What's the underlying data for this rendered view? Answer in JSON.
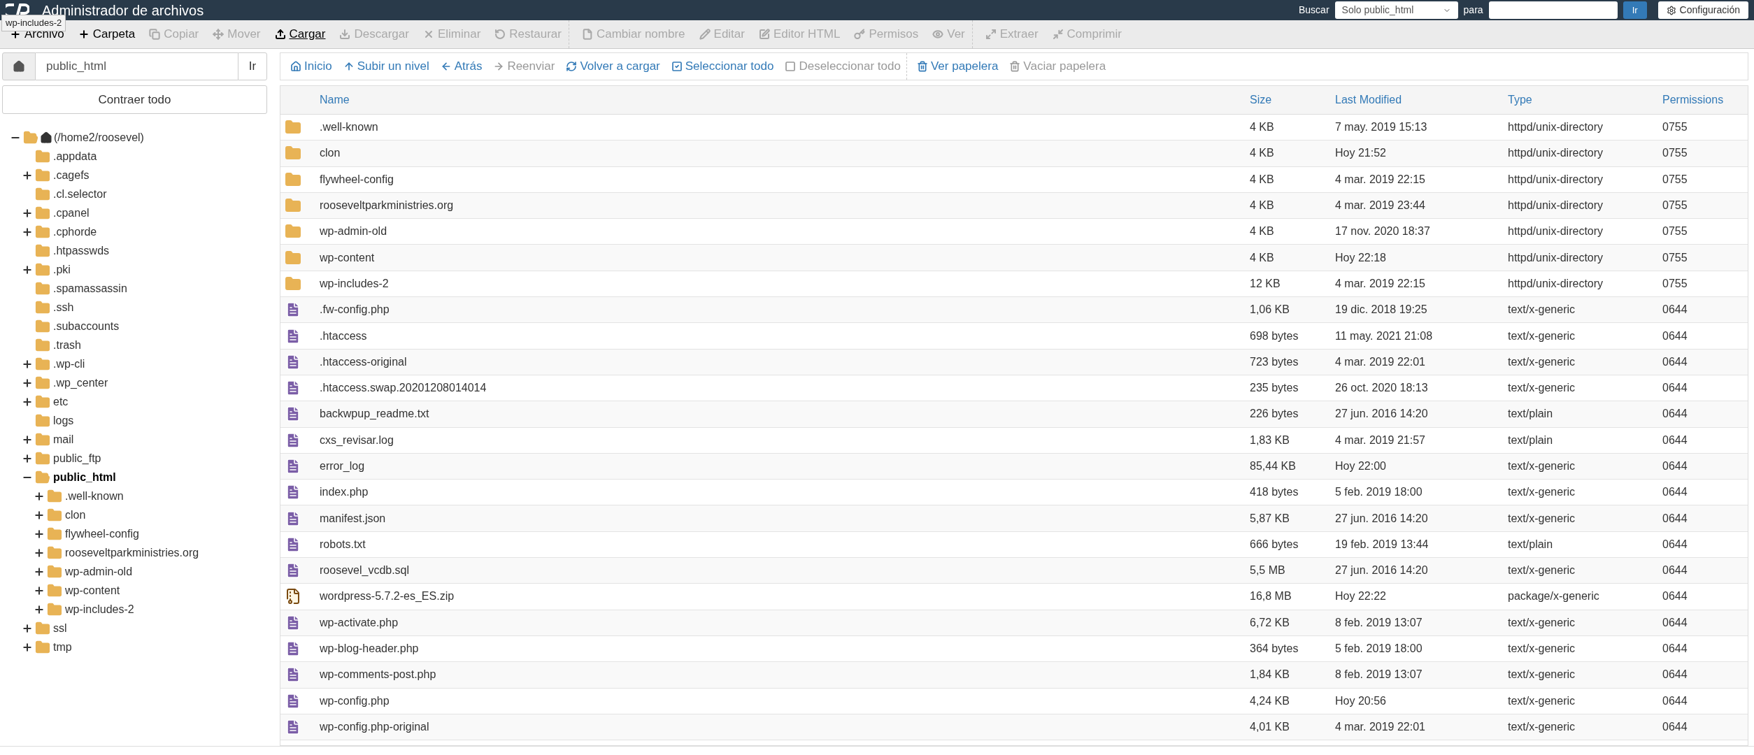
{
  "header": {
    "title": "Administrador de archivos",
    "search_label": "Buscar",
    "search_scope": "Solo public_html",
    "for_label": "para",
    "go_button": "Ir",
    "settings_button": "Configuración"
  },
  "toolbar": [
    [
      {
        "label": "Archivo",
        "disabled": false,
        "hovered": false
      },
      {
        "label": "Carpeta",
        "disabled": false,
        "hovered": false
      },
      {
        "label": "Copiar",
        "disabled": true,
        "hovered": false
      },
      {
        "label": "Mover",
        "disabled": true,
        "hovered": false
      },
      {
        "label": "Cargar",
        "disabled": false,
        "hovered": true
      },
      {
        "label": "Descargar",
        "disabled": true,
        "hovered": false
      },
      {
        "label": "Eliminar",
        "disabled": true,
        "hovered": false
      },
      {
        "label": "Restaurar",
        "disabled": true,
        "hovered": false
      }
    ],
    [
      {
        "label": "Cambiar nombre",
        "disabled": true,
        "hovered": false
      },
      {
        "label": "Editar",
        "disabled": true,
        "hovered": false
      },
      {
        "label": "Editor HTML",
        "disabled": true,
        "hovered": false
      },
      {
        "label": "Permisos",
        "disabled": true,
        "hovered": false
      },
      {
        "label": "Ver",
        "disabled": true,
        "hovered": false
      }
    ],
    [
      {
        "label": "Extraer",
        "disabled": true,
        "hovered": false
      },
      {
        "label": "Comprimir",
        "disabled": true,
        "hovered": false
      }
    ]
  ],
  "tooltip": "wp-includes-2",
  "path": {
    "value": "public_html",
    "go": "Ir"
  },
  "collapse_all": "Contraer todo",
  "tree": [
    {
      "label": "(/home2/roosevel)",
      "home": true,
      "expanded": true,
      "selected": false,
      "children": [
        {
          "label": ".appdata",
          "selected": false
        },
        {
          "label": ".cagefs",
          "expanded": false,
          "selected": false
        },
        {
          "label": ".cl.selector",
          "selected": false
        },
        {
          "label": ".cpanel",
          "expanded": false,
          "selected": false
        },
        {
          "label": ".cphorde",
          "expanded": false,
          "selected": false
        },
        {
          "label": ".htpasswds",
          "selected": false
        },
        {
          "label": ".pki",
          "expanded": false,
          "selected": false
        },
        {
          "label": ".spamassassin",
          "selected": false
        },
        {
          "label": ".ssh",
          "selected": false
        },
        {
          "label": ".subaccounts",
          "selected": false
        },
        {
          "label": ".trash",
          "selected": false
        },
        {
          "label": ".wp-cli",
          "expanded": false,
          "selected": false
        },
        {
          "label": ".wp_center",
          "expanded": false,
          "selected": false
        },
        {
          "label": "etc",
          "expanded": false,
          "selected": false
        },
        {
          "label": "logs",
          "selected": false
        },
        {
          "label": "mail",
          "expanded": false,
          "selected": false
        },
        {
          "label": "public_ftp",
          "expanded": false,
          "selected": false
        },
        {
          "label": "public_html",
          "expanded": true,
          "selected": true,
          "children": [
            {
              "label": ".well-known",
              "expanded": false,
              "selected": false
            },
            {
              "label": "clon",
              "expanded": false,
              "selected": false
            },
            {
              "label": "flywheel-config",
              "expanded": false,
              "selected": false
            },
            {
              "label": "rooseveltparkministries.org",
              "expanded": false,
              "selected": false
            },
            {
              "label": "wp-admin-old",
              "expanded": false,
              "selected": false
            },
            {
              "label": "wp-content",
              "expanded": false,
              "selected": false
            },
            {
              "label": "wp-includes-2",
              "expanded": false,
              "selected": false
            }
          ]
        },
        {
          "label": "ssl",
          "expanded": false,
          "selected": false
        },
        {
          "label": "tmp",
          "expanded": false,
          "selected": false
        }
      ]
    }
  ],
  "nav": [
    [
      {
        "label": "Inicio",
        "disabled": false
      },
      {
        "label": "Subir un nivel",
        "disabled": false
      },
      {
        "label": "Atrás",
        "disabled": false
      },
      {
        "label": "Reenviar",
        "disabled": true
      },
      {
        "label": "Volver a cargar",
        "disabled": false
      },
      {
        "label": "Seleccionar todo",
        "disabled": false
      },
      {
        "label": "Deseleccionar todo",
        "disabled": true
      }
    ],
    [
      {
        "label": "Ver papelera",
        "disabled": false
      },
      {
        "label": "Vaciar papelera",
        "disabled": true
      }
    ]
  ],
  "table": {
    "columns": [
      "Name",
      "Size",
      "Last Modified",
      "Type",
      "Permissions"
    ],
    "rows": [
      {
        "kind": "folder",
        "name": ".well-known",
        "size": "4 KB",
        "modified": "7 may. 2019 15:13",
        "type": "httpd/unix-directory",
        "permissions": "0755"
      },
      {
        "kind": "folder",
        "name": "clon",
        "size": "4 KB",
        "modified": "Hoy 21:52",
        "type": "httpd/unix-directory",
        "permissions": "0755"
      },
      {
        "kind": "folder",
        "name": "flywheel-config",
        "size": "4 KB",
        "modified": "4 mar. 2019 22:15",
        "type": "httpd/unix-directory",
        "permissions": "0755"
      },
      {
        "kind": "folder",
        "name": "rooseveltparkministries.org",
        "size": "4 KB",
        "modified": "4 mar. 2019 23:44",
        "type": "httpd/unix-directory",
        "permissions": "0755"
      },
      {
        "kind": "folder",
        "name": "wp-admin-old",
        "size": "4 KB",
        "modified": "17 nov. 2020 18:37",
        "type": "httpd/unix-directory",
        "permissions": "0755"
      },
      {
        "kind": "folder",
        "name": "wp-content",
        "size": "4 KB",
        "modified": "Hoy 22:18",
        "type": "httpd/unix-directory",
        "permissions": "0755"
      },
      {
        "kind": "folder",
        "name": "wp-includes-2",
        "size": "12 KB",
        "modified": "4 mar. 2019 22:15",
        "type": "httpd/unix-directory",
        "permissions": "0755"
      },
      {
        "kind": "file",
        "name": ".fw-config.php",
        "size": "1,06 KB",
        "modified": "19 dic. 2018 19:25",
        "type": "text/x-generic",
        "permissions": "0644"
      },
      {
        "kind": "file",
        "name": ".htaccess",
        "size": "698 bytes",
        "modified": "11 may. 2021 21:08",
        "type": "text/x-generic",
        "permissions": "0644"
      },
      {
        "kind": "file",
        "name": ".htaccess-original",
        "size": "723 bytes",
        "modified": "4 mar. 2019 22:01",
        "type": "text/x-generic",
        "permissions": "0644"
      },
      {
        "kind": "file",
        "name": ".htaccess.swap.20201208014014",
        "size": "235 bytes",
        "modified": "26 oct. 2020 18:13",
        "type": "text/x-generic",
        "permissions": "0644"
      },
      {
        "kind": "file",
        "name": "backwpup_readme.txt",
        "size": "226 bytes",
        "modified": "27 jun. 2016 14:20",
        "type": "text/plain",
        "permissions": "0644"
      },
      {
        "kind": "file",
        "name": "cxs_revisar.log",
        "size": "1,83 KB",
        "modified": "4 mar. 2019 21:57",
        "type": "text/plain",
        "permissions": "0644"
      },
      {
        "kind": "file",
        "name": "error_log",
        "size": "85,44 KB",
        "modified": "Hoy 22:00",
        "type": "text/x-generic",
        "permissions": "0644"
      },
      {
        "kind": "file",
        "name": "index.php",
        "size": "418 bytes",
        "modified": "5 feb. 2019 18:00",
        "type": "text/x-generic",
        "permissions": "0644"
      },
      {
        "kind": "file",
        "name": "manifest.json",
        "size": "5,87 KB",
        "modified": "27 jun. 2016 14:20",
        "type": "text/x-generic",
        "permissions": "0644"
      },
      {
        "kind": "file",
        "name": "robots.txt",
        "size": "666 bytes",
        "modified": "19 feb. 2019 13:44",
        "type": "text/plain",
        "permissions": "0644"
      },
      {
        "kind": "file",
        "name": "roosevel_vcdb.sql",
        "size": "5,5 MB",
        "modified": "27 jun. 2016 14:20",
        "type": "text/x-generic",
        "permissions": "0644"
      },
      {
        "kind": "zip",
        "name": "wordpress-5.7.2-es_ES.zip",
        "size": "16,8 MB",
        "modified": "Hoy 22:22",
        "type": "package/x-generic",
        "permissions": "0644"
      },
      {
        "kind": "file",
        "name": "wp-activate.php",
        "size": "6,72 KB",
        "modified": "8 feb. 2019 13:07",
        "type": "text/x-generic",
        "permissions": "0644"
      },
      {
        "kind": "file",
        "name": "wp-blog-header.php",
        "size": "364 bytes",
        "modified": "5 feb. 2019 18:00",
        "type": "text/x-generic",
        "permissions": "0644"
      },
      {
        "kind": "file",
        "name": "wp-comments-post.php",
        "size": "1,84 KB",
        "modified": "8 feb. 2019 13:07",
        "type": "text/x-generic",
        "permissions": "0644"
      },
      {
        "kind": "file",
        "name": "wp-config.php",
        "size": "4,24 KB",
        "modified": "Hoy 20:56",
        "type": "text/x-generic",
        "permissions": "0644"
      },
      {
        "kind": "file",
        "name": "wp-config.php-original",
        "size": "4,01 KB",
        "modified": "4 mar. 2019 22:01",
        "type": "text/x-generic",
        "permissions": "0644"
      }
    ]
  }
}
